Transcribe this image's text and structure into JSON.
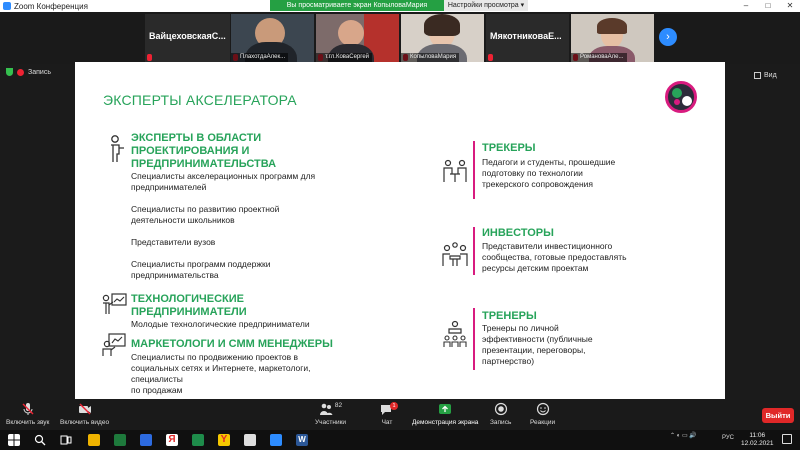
{
  "window": {
    "title": "Zoom Конференция",
    "share_banner": "Вы просматриваете экран КопыловаМария",
    "view_options": "Настройки просмотра ▾"
  },
  "participants": [
    {
      "big_name": "ВайцеховскаяС...",
      "small_name": ""
    },
    {
      "big_name": "",
      "small_name": "ПлахотдаАлек..."
    },
    {
      "big_name": "",
      "small_name": "т.гл.КоваСергей"
    },
    {
      "big_name": "",
      "small_name": "КопыловаМария"
    },
    {
      "big_name": "МякотниковаЕ...",
      "small_name": ""
    },
    {
      "big_name": "",
      "small_name": "РомановаАле..."
    }
  ],
  "recording": {
    "label": "Запись"
  },
  "view_label": "Вид",
  "slide": {
    "title": "ЭКСПЕРТЫ АКСЕЛЕРАТОРА",
    "left": [
      {
        "icon": "teacher-icon",
        "heading": [
          "ЭКСПЕРТЫ В ОБЛАСТИ",
          "ПРОЕКТИРОВАНИЯ И",
          "ПРЕДПРИНИМАТЕЛЬСТВА"
        ],
        "lines": [
          "Специалисты акселерационных программ для",
          "предпринимателей",
          "",
          "Специалисты по развитию проектной",
          "деятельности школьников",
          "",
          "Представители вузов",
          "",
          "Специалисты программ поддержки",
          "предпринимательства"
        ]
      },
      {
        "icon": "presentation-icon",
        "heading": [
          "ТЕХНОЛОГИЧЕСКИЕ",
          "ПРЕДПРИНИМАТЕЛИ"
        ],
        "lines": [
          "Молодые технологические предприниматели"
        ]
      },
      {
        "icon": "marketing-icon",
        "heading": [
          "МАРКЕТОЛОГИ И СММ МЕНЕДЖЕРЫ"
        ],
        "lines": [
          "Специалисты по продвижению проектов в",
          "социальных сетях и Интернете, маркетологи,",
          "специалисты",
          "по продажам"
        ]
      }
    ],
    "right": [
      {
        "icon": "trackers-icon",
        "heading": [
          "ТРЕКЕРЫ"
        ],
        "lines": [
          "Педагоги и студенты, прошедшие",
          "подготовку по технологии",
          "трекерского сопровождения"
        ]
      },
      {
        "icon": "investors-icon",
        "heading": [
          "ИНВЕСТОРЫ"
        ],
        "lines": [
          "Представители инвестиционного",
          "сообщества, готовые предоставлять",
          "ресурсы детским проектам"
        ]
      },
      {
        "icon": "trainers-icon",
        "heading": [
          "ТРЕНЕРЫ"
        ],
        "lines": [
          "Тренеры по личной",
          "эффективности (публичные",
          "презентации, переговоры,",
          "партнерство)"
        ]
      }
    ],
    "colors": {
      "green": "#27a35a",
      "magenta": "#d81b7f"
    }
  },
  "toolbar": {
    "unmute": "Включить звук",
    "start_video": "Включить видео",
    "participants": "Участники",
    "participants_count": "82",
    "chat": "Чат",
    "chat_badge": "1",
    "share": "Демонстрация экрана",
    "record": "Запись",
    "reactions": "Реакции",
    "leave": "Выйти"
  },
  "taskbar": {
    "lang": "РУС",
    "time": "11:06",
    "date": "12.02.2021"
  }
}
